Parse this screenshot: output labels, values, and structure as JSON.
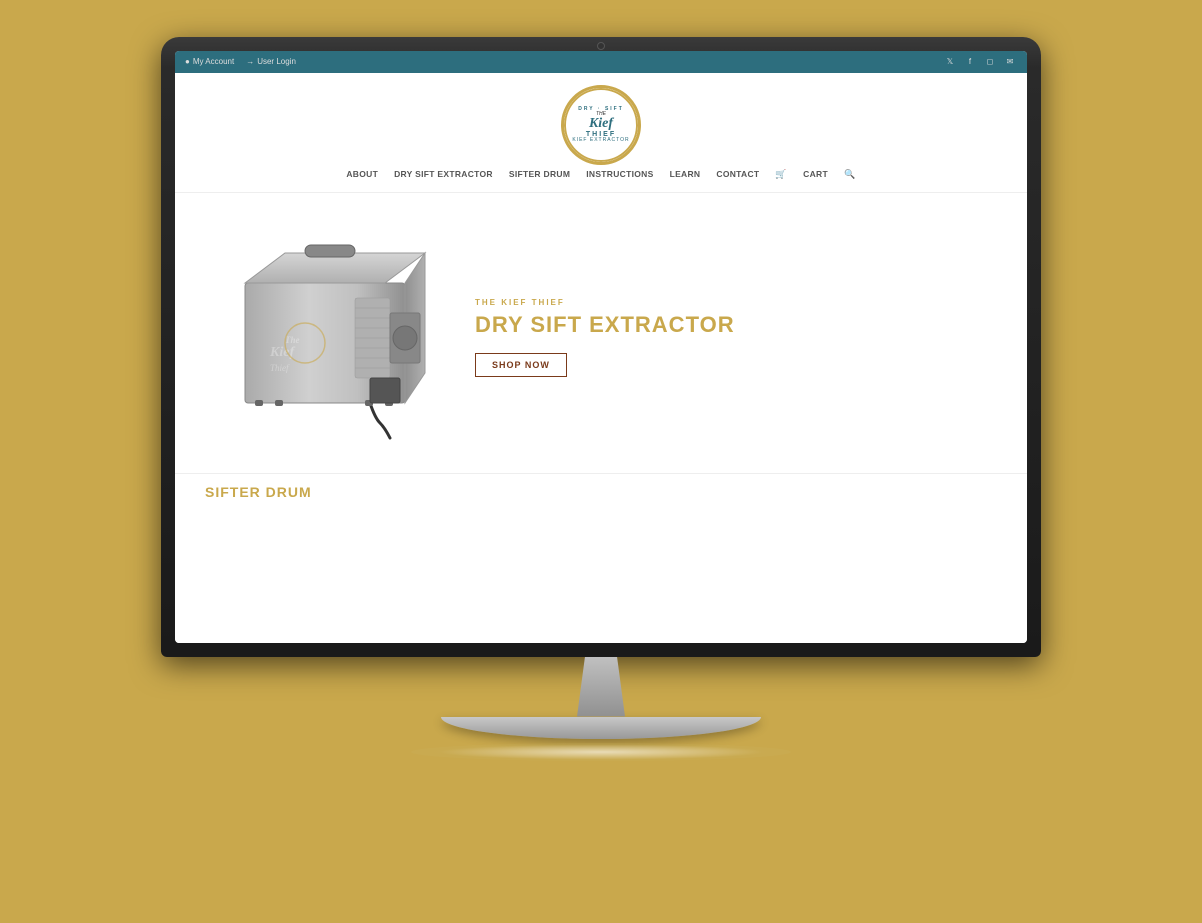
{
  "site": {
    "top_bar": {
      "my_account": "My Account",
      "user_login": "User Login",
      "social": [
        "𝕏",
        "f",
        "📷",
        "✉"
      ]
    },
    "logo": {
      "dry_sift": "DRY · SIFT",
      "the": "THE",
      "kief": "Kief",
      "thief": "THIEF",
      "extractor": "KIEF EXTRACTOR"
    },
    "nav": {
      "items": [
        {
          "label": "ABOUT"
        },
        {
          "label": "DRY SIFT EXTRACTOR"
        },
        {
          "label": "SIFTER DRUM"
        },
        {
          "label": "INSTRUCTIONS"
        },
        {
          "label": "LEARN"
        },
        {
          "label": "CONTACT"
        },
        {
          "label": "CART"
        },
        {
          "label": "🔍"
        }
      ]
    },
    "hero": {
      "brand": "THE KIEF THIEF",
      "title": "DRY SIFT EXTRACTOR",
      "shop_now": "SHOP NOW"
    },
    "teaser": {
      "title": "SIFTER DRUM"
    }
  },
  "colors": {
    "gold": "#c9a84c",
    "teal": "#2d6e7e",
    "dark_brown": "#7a3a1a",
    "nav_text": "#555555"
  }
}
